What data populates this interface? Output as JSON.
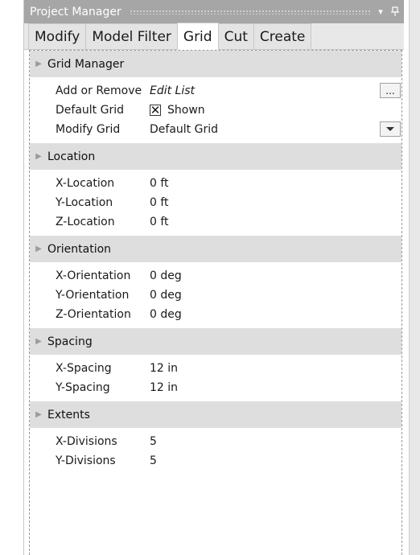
{
  "titlebar": {
    "title": "Project Manager",
    "pin_icon": "pin-icon",
    "menu_icon": "chevron-down-icon"
  },
  "tabs": [
    {
      "label": "Modify",
      "active": false
    },
    {
      "label": "Model Filter",
      "active": false
    },
    {
      "label": "Grid",
      "active": true
    },
    {
      "label": "Cut",
      "active": false
    },
    {
      "label": "Create",
      "active": false
    }
  ],
  "grid_manager": {
    "label": "Grid Manager",
    "add_or_remove": {
      "name": "Add or Remove",
      "value": "Edit List",
      "button": "..."
    },
    "default_grid": {
      "name": "Default Grid",
      "checked": true,
      "value": "Shown"
    },
    "modify_grid": {
      "name": "Modify Grid",
      "value": "Default Grid"
    }
  },
  "location": {
    "label": "Location",
    "rows": [
      {
        "name": "X-Location",
        "value": "0 ft"
      },
      {
        "name": "Y-Location",
        "value": "0 ft"
      },
      {
        "name": "Z-Location",
        "value": "0 ft"
      }
    ]
  },
  "orientation": {
    "label": "Orientation",
    "rows": [
      {
        "name": "X-Orientation",
        "value": "0 deg"
      },
      {
        "name": "Y-Orientation",
        "value": "0 deg"
      },
      {
        "name": "Z-Orientation",
        "value": "0 deg"
      }
    ]
  },
  "spacing": {
    "label": "Spacing",
    "rows": [
      {
        "name": "X-Spacing",
        "value": "12 in"
      },
      {
        "name": "Y-Spacing",
        "value": "12 in"
      }
    ]
  },
  "extents": {
    "label": "Extents",
    "rows": [
      {
        "name": "X-Divisions",
        "value": "5"
      },
      {
        "name": "Y-Divisions",
        "value": "5"
      }
    ]
  }
}
